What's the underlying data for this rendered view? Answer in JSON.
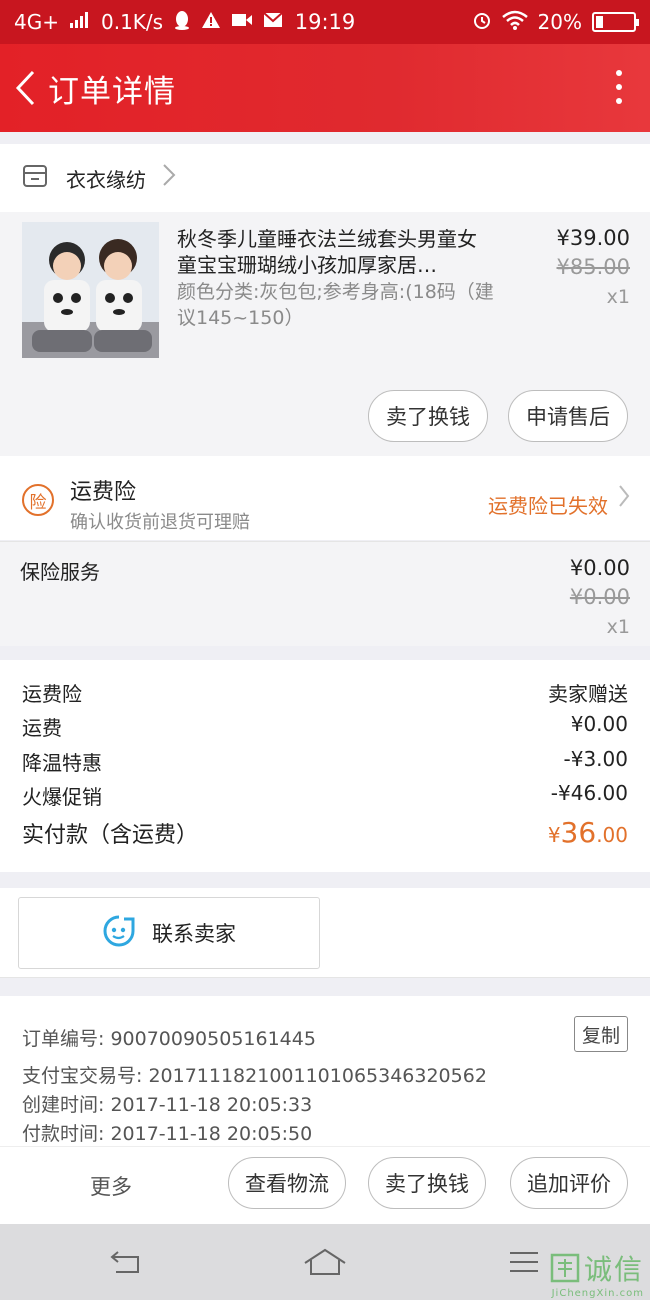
{
  "status_bar": {
    "network": "4G+",
    "speed": "0.1K/s",
    "time": "19:19",
    "battery_text": "20%",
    "battery_level": 0.2,
    "icons": [
      "signal-icon",
      "qq-icon",
      "warning-icon",
      "video-icon",
      "mail-icon",
      "alarm-icon",
      "wifi-icon",
      "battery-icon"
    ]
  },
  "header": {
    "title": "订单详情",
    "back_icon": "chevron-left-icon",
    "menu_icon": "more-vertical-icon",
    "color": "#e32127"
  },
  "store": {
    "name": "衣衣缘纺",
    "icon": "store-icon"
  },
  "product": {
    "title": "秋冬季儿童睡衣法兰绒套头男童女童宝宝珊瑚绒小孩加厚家居…",
    "spec": "颜色分类:灰包包;参考身高:(18码（建议145~150）",
    "price": "¥39.00",
    "original_price": "¥85.00",
    "quantity": "x1",
    "actions": [
      "卖了换钱",
      "申请售后"
    ]
  },
  "freight_insurance": {
    "badge": "险",
    "title": "运费险",
    "subtitle": "确认收货前退货可理赔",
    "status": "运费险已失效",
    "status_color": "#e2712b"
  },
  "insurance_service": {
    "label": "保险服务",
    "price": "¥0.00",
    "original_price": "¥0.00",
    "quantity": "x1"
  },
  "summary": {
    "rows": [
      {
        "key": "运费险",
        "value": "卖家赠送"
      },
      {
        "key": "运费",
        "value": "¥0.00"
      },
      {
        "key": "降温特惠",
        "value": "-¥3.00"
      },
      {
        "key": "火爆促销",
        "value": "-¥46.00"
      }
    ],
    "total_label": "实付款（含运费）",
    "total_currency": "¥",
    "total_int": "36",
    "total_dec": ".00"
  },
  "contact": {
    "label": "联系卖家",
    "icon": "chat-face-icon",
    "icon_color": "#2ea7e0"
  },
  "order_info": {
    "order_no": "订单编号: 90070090505161445",
    "alipay_no": "支付宝交易号: 2017111821001101065346320562",
    "created": "创建时间: 2017-11-18 20:05:33",
    "paid": "付款时间: 2017-11-18 20:05:50",
    "copy_label": "复制"
  },
  "bottom_actions": {
    "more": "更多",
    "buttons": [
      "查看物流",
      "卖了换钱",
      "追加评价"
    ]
  },
  "watermark": {
    "text": "诚信",
    "sub": "JiChengXin.com"
  }
}
